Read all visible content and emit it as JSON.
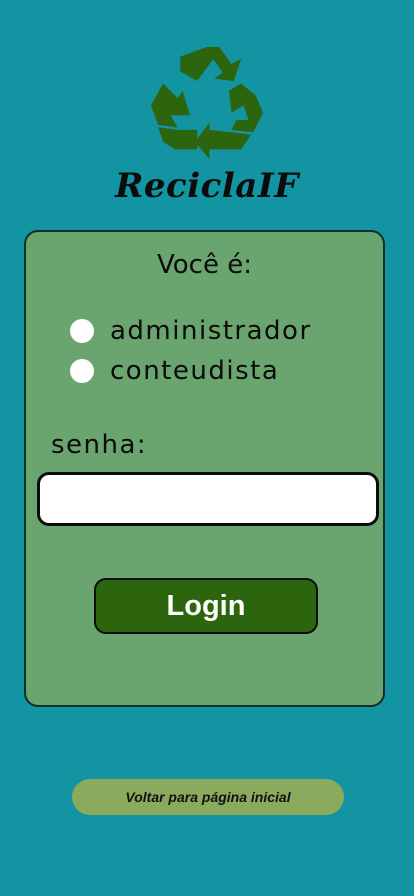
{
  "brand": {
    "name": "ReciclaIF",
    "logo_icon": "recycle-icon",
    "logo_color": "#2c650e"
  },
  "form": {
    "question": "Você é:",
    "roles": [
      {
        "label": "administrador"
      },
      {
        "label": "conteudista"
      }
    ],
    "password_label": "senha:",
    "password_value": "",
    "login_label": "Login"
  },
  "back_link": {
    "label": "Voltar para página inicial"
  },
  "colors": {
    "background": "#1294a3",
    "card": "#6aa46e",
    "login_button": "#2c650e",
    "back_button": "#8aaa5e"
  }
}
